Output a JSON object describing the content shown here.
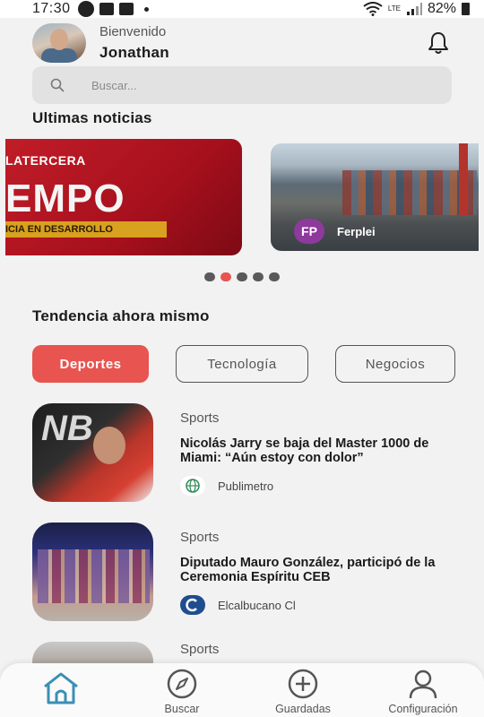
{
  "status_bar": {
    "time": "17:30",
    "network": "LTE",
    "battery": "82%"
  },
  "header": {
    "greeting": "Bienvenido",
    "user_name": "Jonathan"
  },
  "search": {
    "placeholder": "Buscar..."
  },
  "latest": {
    "title": "Ultimas noticias",
    "cards": [
      {
        "brand": "LATERCERA",
        "headline": "EMPO",
        "ribbon": "ICIA EN DESARROLLO"
      },
      {
        "source_initials": "FP",
        "source_name": "Ferplei"
      }
    ],
    "carousel": {
      "count": 5,
      "active_index": 1
    }
  },
  "trending": {
    "title": "Tendencia ahora mismo",
    "chips": [
      {
        "label": "Deportes",
        "active": true
      },
      {
        "label": "Tecnología",
        "active": false
      },
      {
        "label": "Negocios",
        "active": false
      }
    ]
  },
  "articles": [
    {
      "category": "Sports",
      "title": "Nicolás Jarry se baja del Master 1000 de Miami: “Aún estoy con dolor”",
      "source": "Publimetro",
      "source_icon": "globe-icon",
      "thumb_text": "NB"
    },
    {
      "category": "Sports",
      "title": "Diputado Mauro González, participó de la Ceremonia Espíritu CEB",
      "source": "Elcalbucano Cl",
      "source_icon": "elcalbucano-logo"
    },
    {
      "category": "Sports",
      "title": "",
      "source": ""
    }
  ],
  "bottom_nav": {
    "items": [
      {
        "label": "",
        "icon": "home-icon",
        "active": true
      },
      {
        "label": "Buscar",
        "icon": "compass-icon"
      },
      {
        "label": "Guardadas",
        "icon": "plus-circle-icon"
      },
      {
        "label": "Configuración",
        "icon": "user-icon"
      }
    ],
    "active_color": "#3b8fb4"
  },
  "colors": {
    "accent": "#e85450",
    "background": "#f2f2f2",
    "text": "#1c1c1c",
    "nav_active": "#3b8fb4"
  }
}
